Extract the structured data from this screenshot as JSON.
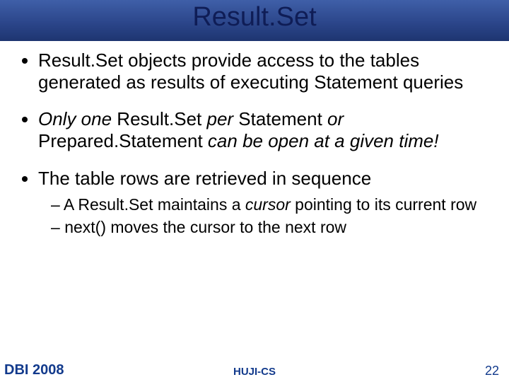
{
  "title": "Result.Set",
  "bullets": [
    {
      "runs": [
        {
          "t": "Result.Set objects provide access to the tables generated as results of executing Statement queries",
          "i": false
        }
      ],
      "sub": []
    },
    {
      "runs": [
        {
          "t": "Only one",
          "i": true
        },
        {
          "t": " Result.Set ",
          "i": false
        },
        {
          "t": "per",
          "i": true
        },
        {
          "t": " Statement ",
          "i": false
        },
        {
          "t": "or",
          "i": true
        },
        {
          "t": " Prepared.Statement ",
          "i": false
        },
        {
          "t": "can be open at a given time!",
          "i": true
        }
      ],
      "sub": []
    },
    {
      "runs": [
        {
          "t": "The table rows are retrieved in sequence",
          "i": false
        }
      ],
      "sub": [
        {
          "runs": [
            {
              "t": "A Result.Set maintains a ",
              "i": false
            },
            {
              "t": "cursor",
              "i": true
            },
            {
              "t": " pointing to its current row",
              "i": false
            }
          ]
        },
        {
          "runs": [
            {
              "t": "next() moves the cursor to the next row",
              "i": false
            }
          ]
        }
      ]
    }
  ],
  "footer": {
    "left": "DBI 2008",
    "center": "HUJI-CS",
    "right": "22"
  }
}
